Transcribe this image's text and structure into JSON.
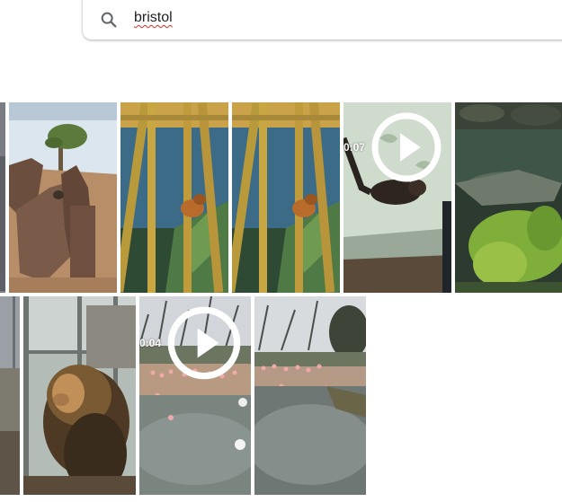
{
  "search": {
    "query": "bristol",
    "icon": "search-icon"
  },
  "photos": {
    "row1": [
      {
        "subject": "sliver"
      },
      {
        "subject": "meerkat-enclosure"
      },
      {
        "subject": "bamboo-monkey"
      },
      {
        "subject": "bamboo-monkey"
      },
      {
        "subject": "animal-on-wall",
        "video_duration": "0:07"
      },
      {
        "subject": "fish-pond"
      }
    ],
    "row2": [
      {
        "subject": "sliver"
      },
      {
        "subject": "lion"
      },
      {
        "subject": "flamingo-lake",
        "video_duration": "0:04"
      },
      {
        "subject": "flamingo-lake"
      }
    ]
  },
  "icons": {
    "play": "play-circle-icon"
  }
}
